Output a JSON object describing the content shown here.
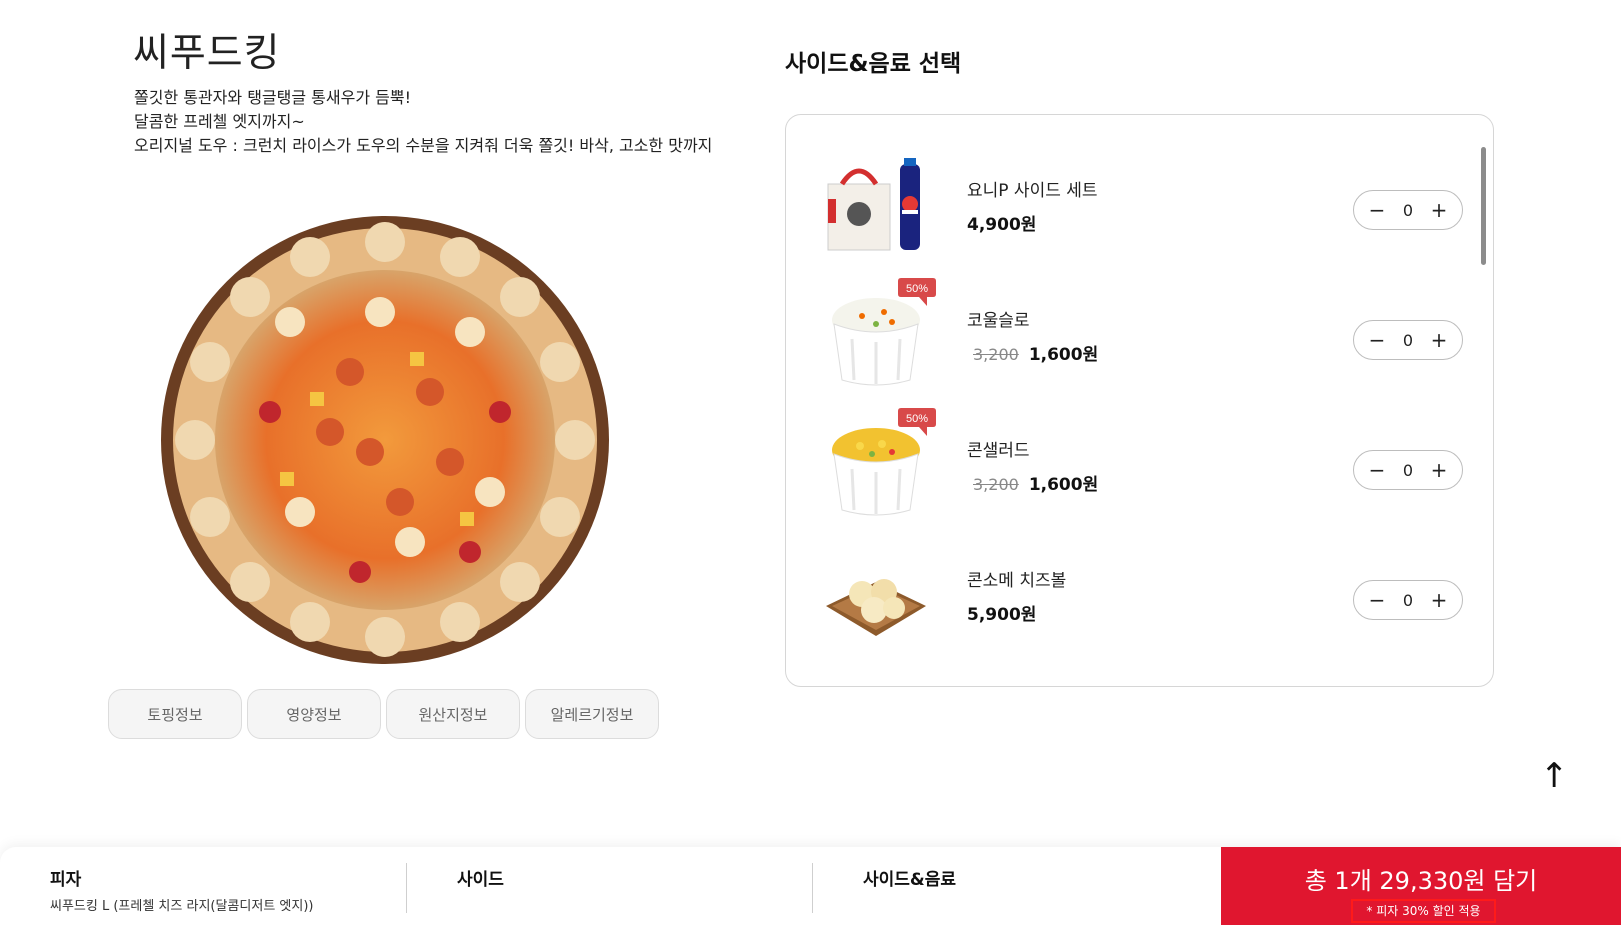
{
  "pizza": {
    "title": "씨푸드킹",
    "desc_lines": [
      "쫄깃한 통관자와 탱글탱글 통새우가 듬뿍!",
      "달콤한 프레첼 엣지까지~",
      "오리지널 도우 : 크런치 라이스가 도우의 수분을 지켜줘 더욱 쫄깃! 바삭, 고소한 맛까지"
    ]
  },
  "info_tabs": [
    "토핑정보",
    "영양정보",
    "원산지정보",
    "알레르기정보"
  ],
  "side_section": {
    "title": "사이드&음료 선택",
    "items": [
      {
        "name": "요니P 사이드 세트",
        "price": "4,900원",
        "old_price": "",
        "badge": "",
        "qty": "0",
        "icon": "bag-and-cola-image"
      },
      {
        "name": "코울슬로",
        "price": "1,600원",
        "old_price": "3,200",
        "badge": "50%",
        "qty": "0",
        "icon": "coleslaw-cup-image"
      },
      {
        "name": "콘샐러드",
        "price": "1,600원",
        "old_price": "3,200",
        "badge": "50%",
        "qty": "0",
        "icon": "corn-salad-cup-image"
      },
      {
        "name": "콘소메 치즈볼",
        "price": "5,900원",
        "old_price": "",
        "badge": "",
        "qty": "0",
        "icon": "cheese-ball-tray-image"
      }
    ],
    "minus": "−",
    "plus": "+"
  },
  "scroll_top": "↑",
  "bottom_bar": {
    "pizza_label": "피자",
    "pizza_value": "씨푸드킹 L (프레첼 치즈 라지(달콤디저트 엣지))",
    "side_label": "사이드",
    "side_value": "",
    "drink_label": "사이드&음료",
    "drink_value": "",
    "cart_label": "총 1개 29,330원 담기",
    "cart_note": "* 피자 30% 할인 적용"
  },
  "colors": {
    "brand_red": "#e0162f",
    "badge_red": "#d84a4a"
  }
}
